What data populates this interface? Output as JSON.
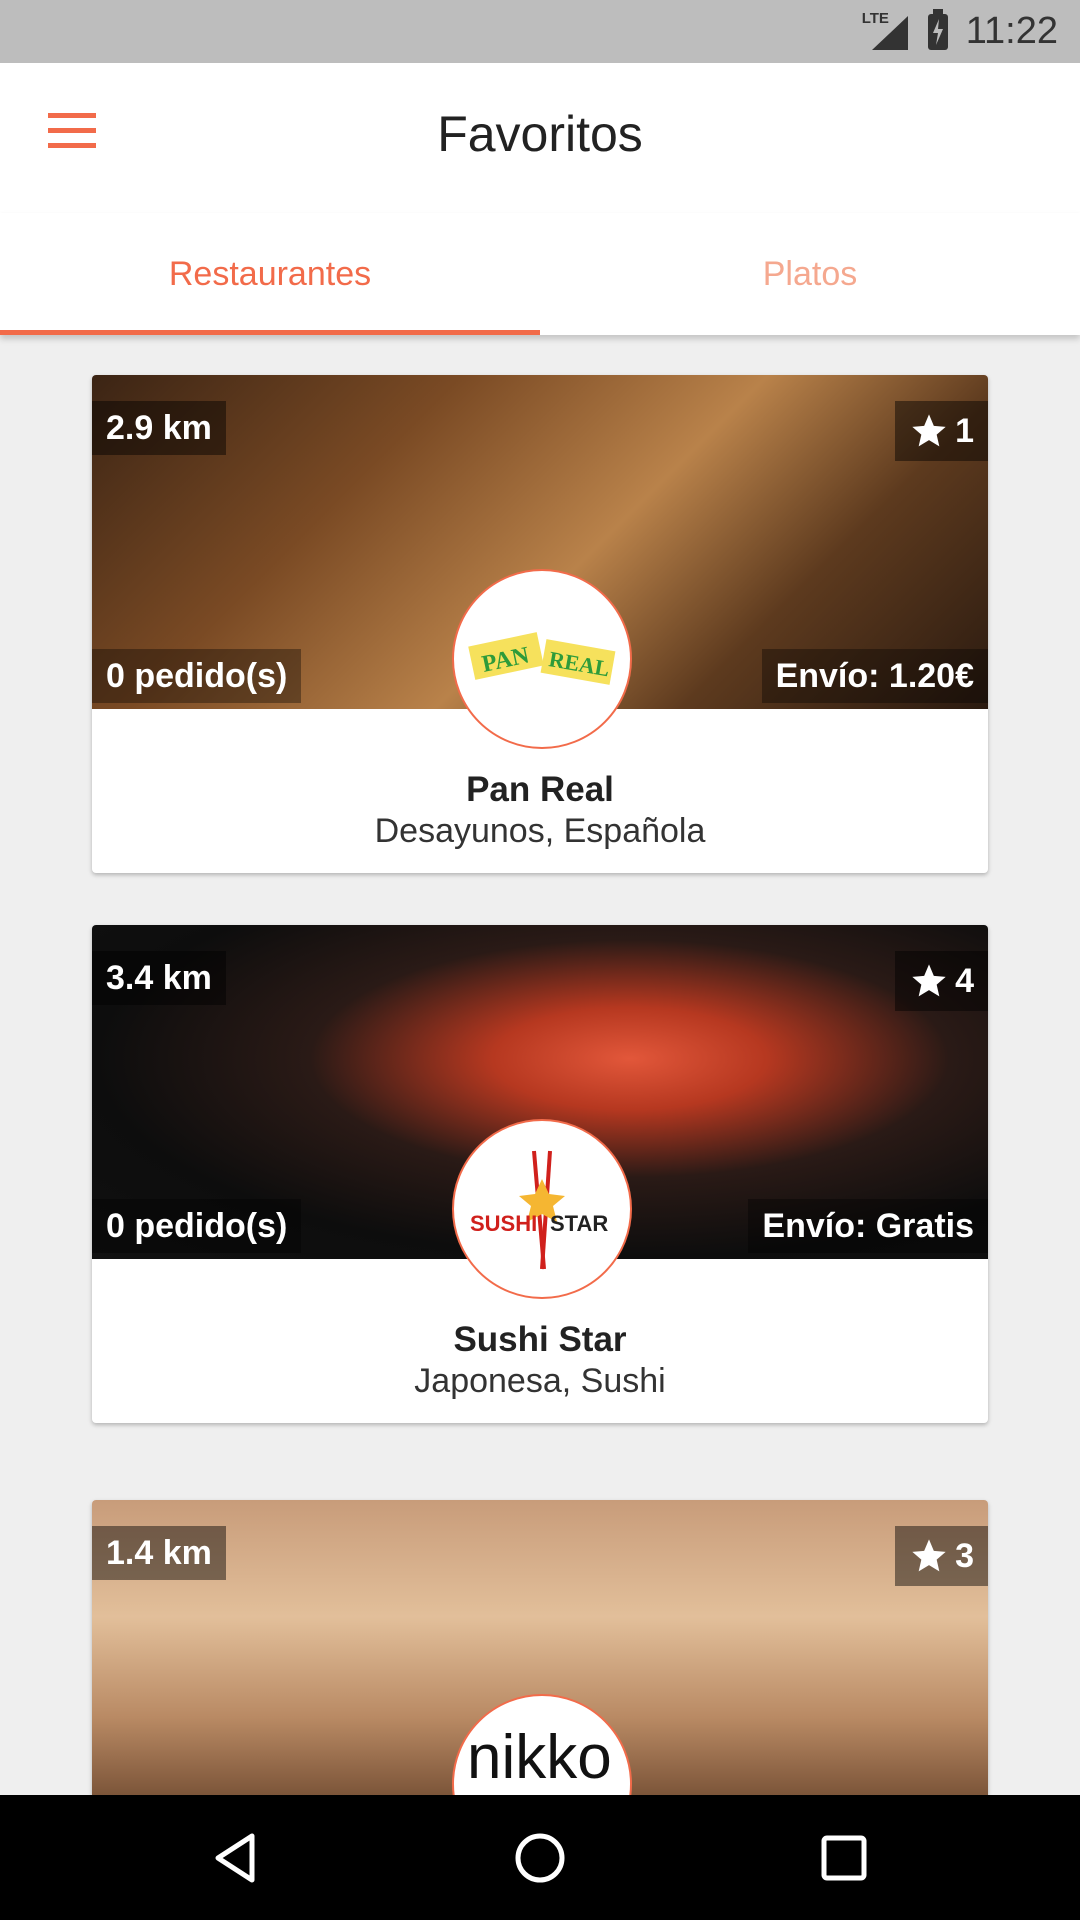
{
  "status_bar": {
    "time": "11:22",
    "network": "LTE",
    "icons": [
      "signal-icon",
      "battery-charging-icon"
    ]
  },
  "toolbar": {
    "title": "Favoritos",
    "menu_icon": "hamburger-menu-icon"
  },
  "tabs": [
    {
      "label": "Restaurantes",
      "active": true
    },
    {
      "label": "Platos",
      "active": false
    }
  ],
  "colors": {
    "accent": "#f26b4a",
    "accent_light": "#f5a88f",
    "background": "#efefef"
  },
  "restaurants": [
    {
      "distance": "2.9 km",
      "rating": "1",
      "orders": "0 pedido(s)",
      "shipping": "Envío: 1.20€",
      "name": "Pan Real",
      "cuisine": "Desayunos, Española",
      "logo_text_1": "PAN",
      "logo_text_2": "REAL"
    },
    {
      "distance": "3.4 km",
      "rating": "4",
      "orders": "0 pedido(s)",
      "shipping": "Envío: Gratis",
      "name": "Sushi Star",
      "cuisine": "Japonesa, Sushi",
      "logo_text_1": "SUSHI",
      "logo_text_2": "STAR"
    },
    {
      "distance": "1.4 km",
      "rating": "3",
      "logo_text_1": "nikko"
    }
  ],
  "nav_bar": {
    "icons": [
      "back-icon",
      "home-icon",
      "recents-icon"
    ]
  }
}
